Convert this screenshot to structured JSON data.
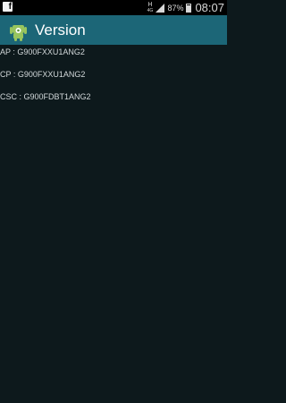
{
  "status_bar": {
    "left_icon": "facebook-icon",
    "network_label": "H",
    "network_sub": "4G",
    "battery_percent": "87%",
    "time": "08:07",
    "battery_level": 0.87
  },
  "action_bar": {
    "icon": "android-icon",
    "title": "Version"
  },
  "versions": [
    {
      "label": "AP : G900FXXU1ANG2"
    },
    {
      "label": "CP : G900FXXU1ANG2"
    },
    {
      "label": "CSC : G900FDBT1ANG2"
    }
  ],
  "colors": {
    "status_bar_bg": "#000000",
    "action_bar_bg": "#1c6677",
    "content_bg": "#0d191c",
    "text": "#d2d8da"
  }
}
